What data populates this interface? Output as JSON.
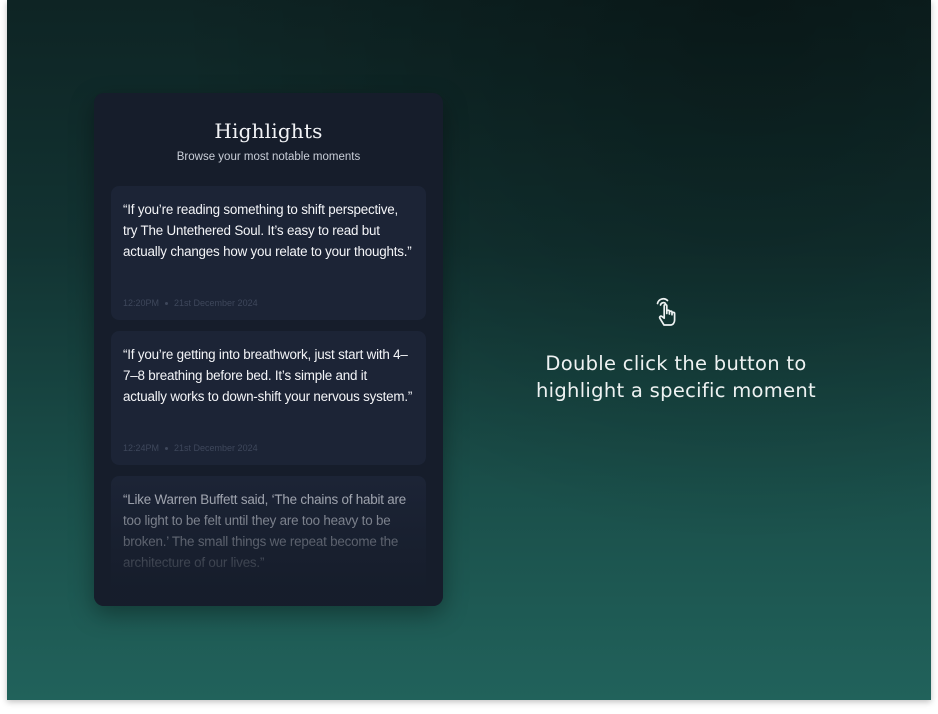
{
  "highlights": {
    "title": "Highlights",
    "subtitle": "Browse your most notable moments",
    "items": [
      {
        "quote": "“If you’re reading something to shift perspective, try The Untethered Soul. It’s easy to read but actually changes how you relate to your thoughts.”",
        "time": "12:20PM",
        "date": "21st December 2024"
      },
      {
        "quote": "“If you’re getting into breathwork, just start with 4–7–8 breathing before bed. It’s simple and it actually works to down-shift your nervous system.”",
        "time": "12:24PM",
        "date": "21st December 2024"
      },
      {
        "quote": "“Like Warren Buffett said, ‘The chains of habit are too light to be felt until they are too heavy to be broken.’ The small things we repeat become the architecture of our lives.”"
      }
    ]
  },
  "hint": {
    "icon": "pointer-hand-icon",
    "text": "Double click the button to highlight a specific moment"
  },
  "colors": {
    "background_top": "#0e2424",
    "background_bottom": "#21625b",
    "panel": "#161d2b",
    "card": "#1c2436"
  }
}
